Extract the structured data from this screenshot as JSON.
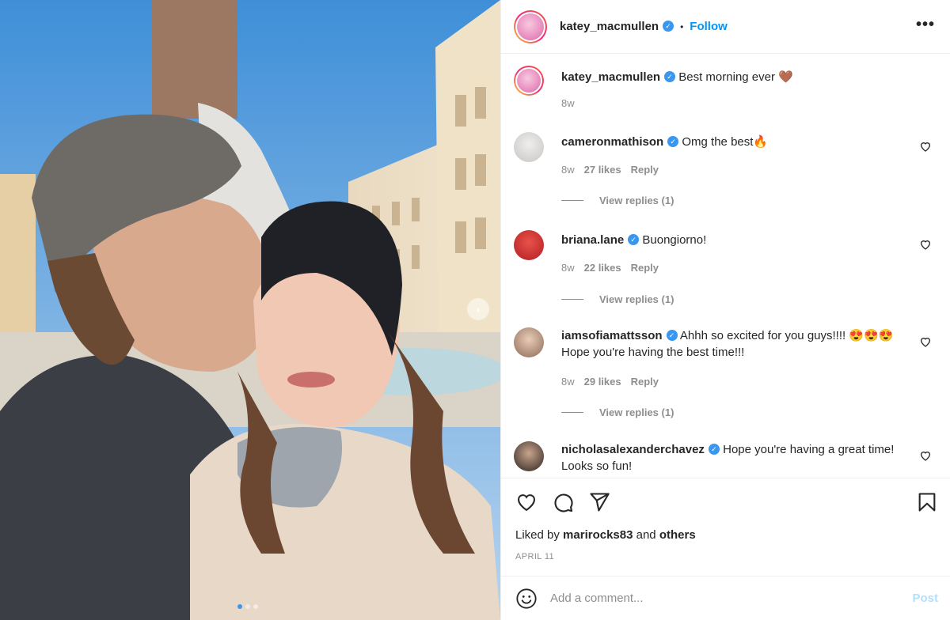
{
  "post": {
    "author": "katey_macmullen",
    "follow_label": "Follow",
    "separator": "•",
    "more_label": "•••",
    "caption": "Best morning ever 🤎",
    "caption_time": "8w"
  },
  "comments": [
    {
      "user": "cameronmathison",
      "text": "Omg the best🔥",
      "time": "8w",
      "likes": "27 likes",
      "reply": "Reply",
      "view_replies": "View replies (1)"
    },
    {
      "user": "briana.lane",
      "text": "Buongiorno!",
      "time": "8w",
      "likes": "22 likes",
      "reply": "Reply",
      "view_replies": "View replies (1)"
    },
    {
      "user": "iamsofiamattsson",
      "text": "Ahhh so excited for you guys!!!! 😍😍😍 Hope you're having the best time!!!",
      "time": "8w",
      "likes": "29 likes",
      "reply": "Reply",
      "view_replies": "View replies (1)"
    },
    {
      "user": "nicholasalexanderchavez",
      "text": "Hope you're having a great time! Looks so fun!"
    }
  ],
  "likes": {
    "prefix": "Liked by",
    "user": "marirocks83",
    "and": "and",
    "others": "others"
  },
  "date": "APRIL 11",
  "add_comment": {
    "placeholder": "Add a comment...",
    "post_label": "Post"
  },
  "carousel": {
    "next_glyph": "›"
  },
  "icons": {
    "verified": "verified-badge-icon",
    "like": "heart-icon",
    "comment": "comment-bubble-icon",
    "share": "paper-plane-icon",
    "save": "bookmark-icon",
    "emoji": "smiley-icon"
  },
  "colors": {
    "link_blue": "#0095f6",
    "verified_blue": "#3897f0",
    "muted": "#8e8e8e",
    "post_disabled": "#b2dffc"
  }
}
